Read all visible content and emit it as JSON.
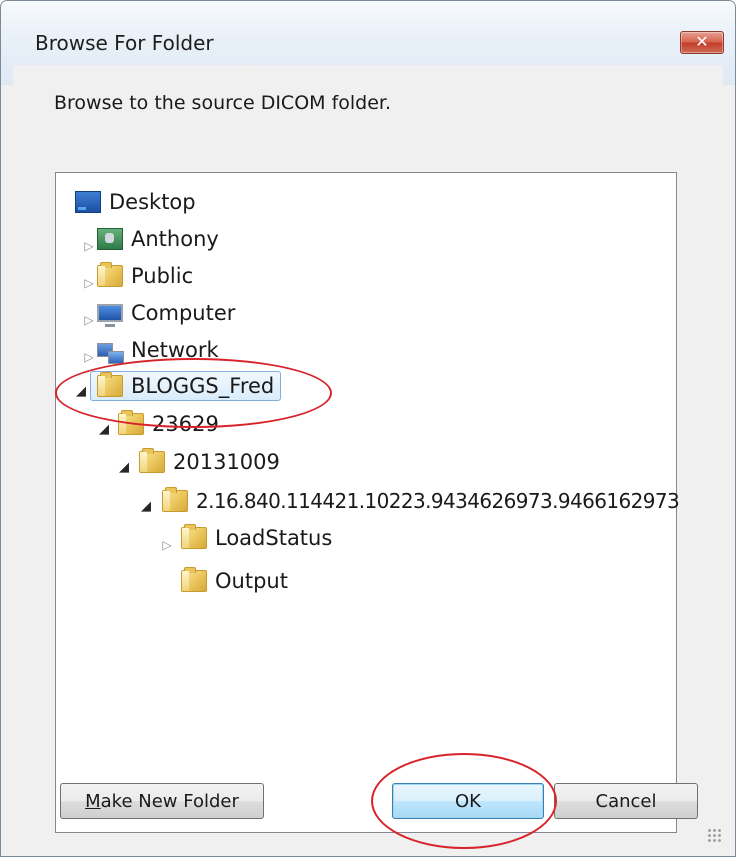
{
  "window": {
    "title": "Browse For Folder",
    "close_glyph": "✕"
  },
  "instruction": "Browse to the source DICOM folder.",
  "tree": {
    "nodes": [
      {
        "label": "Desktop",
        "icon": "desktop-icon",
        "expander": "none"
      },
      {
        "label": "Anthony",
        "icon": "user-icon",
        "expander": "collapsed"
      },
      {
        "label": "Public",
        "icon": "folder-icon",
        "expander": "collapsed"
      },
      {
        "label": "Computer",
        "icon": "computer-icon",
        "expander": "collapsed"
      },
      {
        "label": "Network",
        "icon": "network-icon",
        "expander": "collapsed"
      },
      {
        "label": "BLOGGS_Fred",
        "icon": "folder-icon",
        "expander": "expanded",
        "selected": true
      },
      {
        "label": "23629",
        "icon": "folder-icon",
        "expander": "expanded"
      },
      {
        "label": "20131009",
        "icon": "folder-icon",
        "expander": "expanded"
      },
      {
        "label": "2.16.840.114421.10223.9434626973.9466162973",
        "icon": "folder-icon",
        "expander": "expanded"
      },
      {
        "label": "LoadStatus",
        "icon": "folder-icon",
        "expander": "collapsed"
      },
      {
        "label": "Output",
        "icon": "folder-icon",
        "expander": "none"
      }
    ],
    "expander_glyphs": {
      "collapsed": "▷",
      "expanded": "◢"
    }
  },
  "buttons": {
    "make_new_folder_prefix": "M",
    "make_new_folder_rest": "ake New Folder",
    "ok": "OK",
    "cancel": "Cancel"
  },
  "colors": {
    "annotation": "#d8232a",
    "selection_border": "#84acdd"
  }
}
